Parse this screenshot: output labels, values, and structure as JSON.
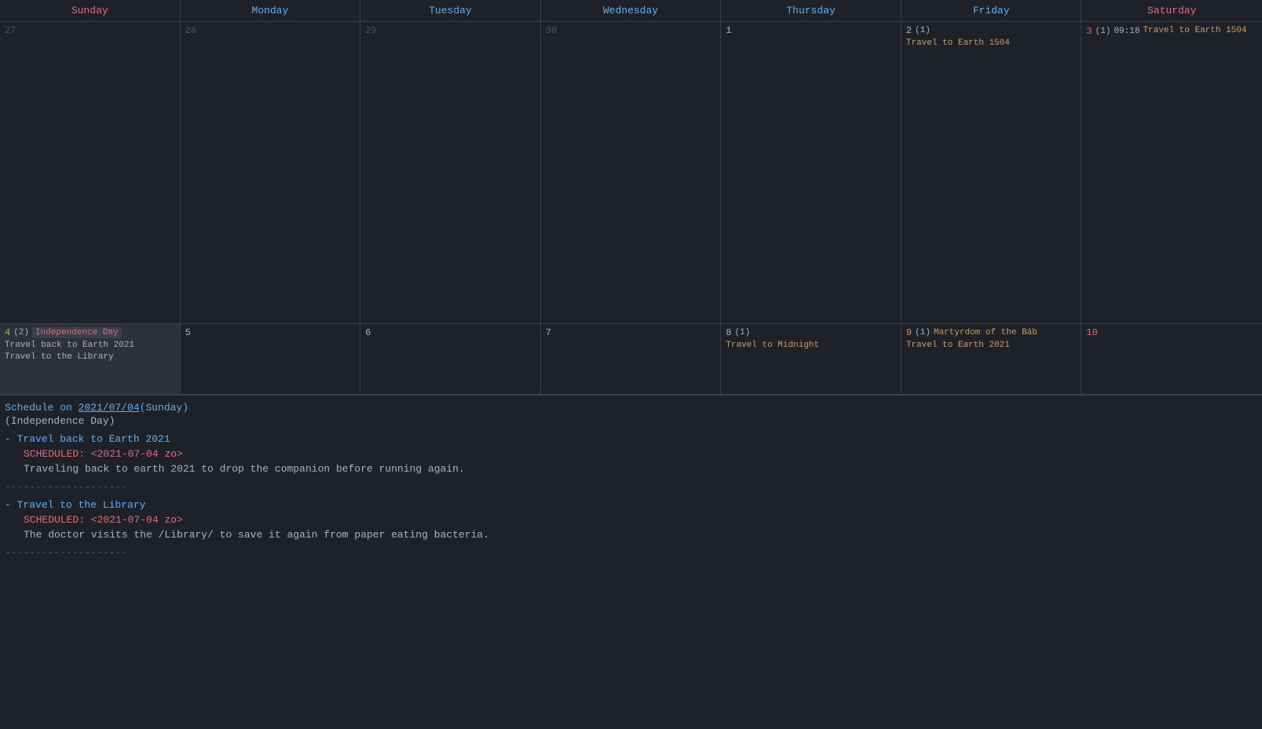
{
  "calendar": {
    "headers": [
      {
        "label": "Sunday",
        "class": "sunday-header"
      },
      {
        "label": "Monday",
        "class": "monday-header"
      },
      {
        "label": "Tuesday",
        "class": "tuesday-header"
      },
      {
        "label": "Wednesday",
        "class": "wednesday-header"
      },
      {
        "label": "Thursday",
        "class": "thursday-header"
      },
      {
        "label": "Friday",
        "class": "friday-header"
      },
      {
        "label": "Saturday",
        "class": "saturday-header"
      }
    ],
    "row1": [
      {
        "date": "27",
        "dateClass": "dim-date",
        "events": []
      },
      {
        "date": "28",
        "dateClass": "dim-date",
        "events": []
      },
      {
        "date": "29",
        "dateClass": "dim-date",
        "events": []
      },
      {
        "date": "30",
        "dateClass": "dim-date",
        "events": []
      },
      {
        "date": "1",
        "dateClass": "date-num",
        "events": []
      },
      {
        "date": "2",
        "dateClass": "date-num",
        "count": "(1)",
        "events": [
          {
            "text": "Travel to Earth 1504",
            "class": "event-item"
          }
        ]
      },
      {
        "date": "3",
        "dateClass": "date-num-red",
        "count": "(1)",
        "time": "09:18",
        "events": [
          {
            "text": "Travel to Earth 1504",
            "class": "event-item"
          }
        ]
      }
    ],
    "row2": [
      {
        "date": "4",
        "dateClass": "date-num-orange",
        "count": "(2)",
        "holiday": "Independence Day",
        "selected": true,
        "events": [
          {
            "text": "Travel back to Earth 2021",
            "class": "event-text-plain"
          },
          {
            "text": "Travel to the Library",
            "class": "event-text-plain"
          }
        ]
      },
      {
        "date": "5",
        "dateClass": "date-num",
        "events": []
      },
      {
        "date": "6",
        "dateClass": "date-num",
        "events": []
      },
      {
        "date": "7",
        "dateClass": "date-num",
        "events": []
      },
      {
        "date": "8",
        "dateClass": "date-num",
        "count": "(1)",
        "events": [
          {
            "text": "Travel to Midnight",
            "class": "event-item"
          }
        ]
      },
      {
        "date": "9",
        "dateClass": "date-num-orange",
        "count": "(1)",
        "holiday": "Martyrdom of the Báb",
        "events": [
          {
            "text": "Travel to Earth 2021",
            "class": "event-item"
          }
        ]
      },
      {
        "date": "10",
        "dateClass": "date-num-red",
        "events": []
      }
    ]
  },
  "schedule": {
    "date_link": "2021/07/04",
    "day_label": "(Sunday)",
    "holiday": "(Independence Day)",
    "entries": [
      {
        "title": "Travel back to Earth 2021",
        "scheduled_label": "SCHEDULED:",
        "scheduled_value": "<2021-07-04 zo>",
        "description": "Traveling back to earth 2021 to drop the companion before running again."
      },
      {
        "title": "Travel to the Library",
        "scheduled_label": "SCHEDULED:",
        "scheduled_value": "<2021-07-04 zo>",
        "description": "The doctor visits the /Library/ to save it again from paper eating bacteria."
      }
    ],
    "divider": "--------------------"
  }
}
